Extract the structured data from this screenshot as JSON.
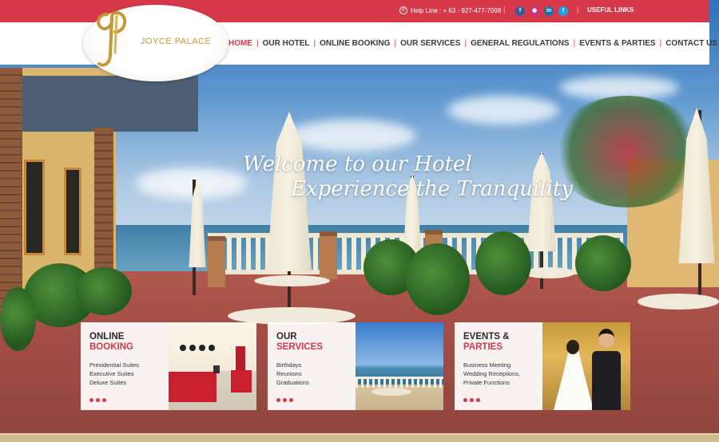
{
  "topbar": {
    "helpline": "Help Line : + 63 - 927-477-7098",
    "social": [
      "facebook-icon",
      "instagram-icon",
      "linkedin-icon",
      "twitter-icon"
    ],
    "useful_links": "USEFUL LINKS"
  },
  "logo": {
    "text": "JOYCE PALACE"
  },
  "nav": {
    "items": [
      {
        "label": "HOME",
        "active": true
      },
      {
        "label": "OUR HOTEL"
      },
      {
        "label": "ONLINE BOOKING"
      },
      {
        "label": "OUR SERVICES"
      },
      {
        "label": "GENERAL REGULATIONS"
      },
      {
        "label": "EVENTS & PARTIES"
      },
      {
        "label": "CONTACT US"
      }
    ]
  },
  "hero": {
    "line1": "Welcome to our Hotel",
    "line2": "Experience the Tranquility"
  },
  "cards": [
    {
      "title1": "ONLINE",
      "title2": "BOOKING",
      "items": [
        "Presidential Suites",
        "Executive Suites",
        "Deluxe Suites"
      ]
    },
    {
      "title1": "OUR",
      "title2": "SERVICES",
      "items": [
        "Birthdays",
        "Reunions",
        "Graduations"
      ]
    },
    {
      "title1": "EVENTS &",
      "title2": "PARTIES",
      "items": [
        "Business Meeting",
        "Wedding Receptions,",
        "Private Functions"
      ]
    }
  ],
  "colors": {
    "accent": "#d6394a",
    "gold": "#c49a36"
  }
}
